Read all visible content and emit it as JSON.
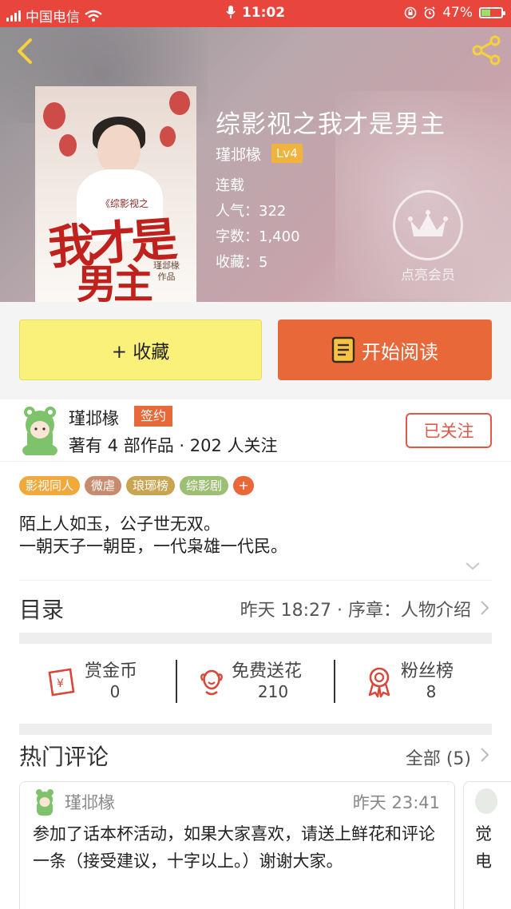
{
  "status_bar": {
    "carrier": "中国电信",
    "time": "11:02",
    "battery": "47%",
    "battery_level": 0.47
  },
  "book": {
    "title": "综影视之我才是男主",
    "author": "瑾邶椽",
    "level": "Lv4",
    "status": "连载",
    "popularity": "人气：322",
    "word_count": "字数：1,400",
    "favorites": "收藏：5",
    "vip_label": "点亮会员",
    "cover": {
      "subtitle": "《综影视之",
      "title_line1": "我才是",
      "title_line2": "男主",
      "byline": "瑾邶椽\n作品"
    }
  },
  "actions": {
    "collect_label": "+ 收藏",
    "read_label": "开始阅读"
  },
  "author_info": {
    "name": "瑾邶椽",
    "badge": "签约",
    "summary": "著有 4 部作品 · 202 人关注",
    "follow_label": "已关注"
  },
  "tags": [
    {
      "label": "影视同人",
      "color": "#f0a93a"
    },
    {
      "label": "微虐",
      "color": "#c98b6e"
    },
    {
      "label": "琅琊榜",
      "color": "#c9a451"
    },
    {
      "label": "综影剧",
      "color": "#9bbf73"
    }
  ],
  "tag_more": "+",
  "intro": {
    "line1": "陌上人如玉，公子世无双。",
    "line2": "一朝天子一朝臣，一代枭雄一代民。"
  },
  "toc": {
    "title": "目录",
    "latest": "昨天 18:27 · 序章：人物介绍"
  },
  "stats": {
    "reward": {
      "label": "赏金币",
      "value": "0"
    },
    "flower": {
      "label": "免费送花",
      "value": "210"
    },
    "fans": {
      "label": "粉丝榜",
      "value": "8"
    }
  },
  "comments_section": {
    "title": "热门评论",
    "all_label": "全部 (5)"
  },
  "comments": [
    {
      "name": "瑾邶椽",
      "time": "昨天 23:41",
      "text": "参加了话本杯活动，如果大家喜欢，请送上鲜花和评论一条（接受建议，十字以上。）谢谢大家。"
    }
  ],
  "comment_peek": "觉\n电",
  "colors": {
    "status_red": "#e8453c",
    "accent_orange": "#e8683a",
    "collect_yellow": "#faf17a",
    "badge_gold": "#f2b33d"
  }
}
